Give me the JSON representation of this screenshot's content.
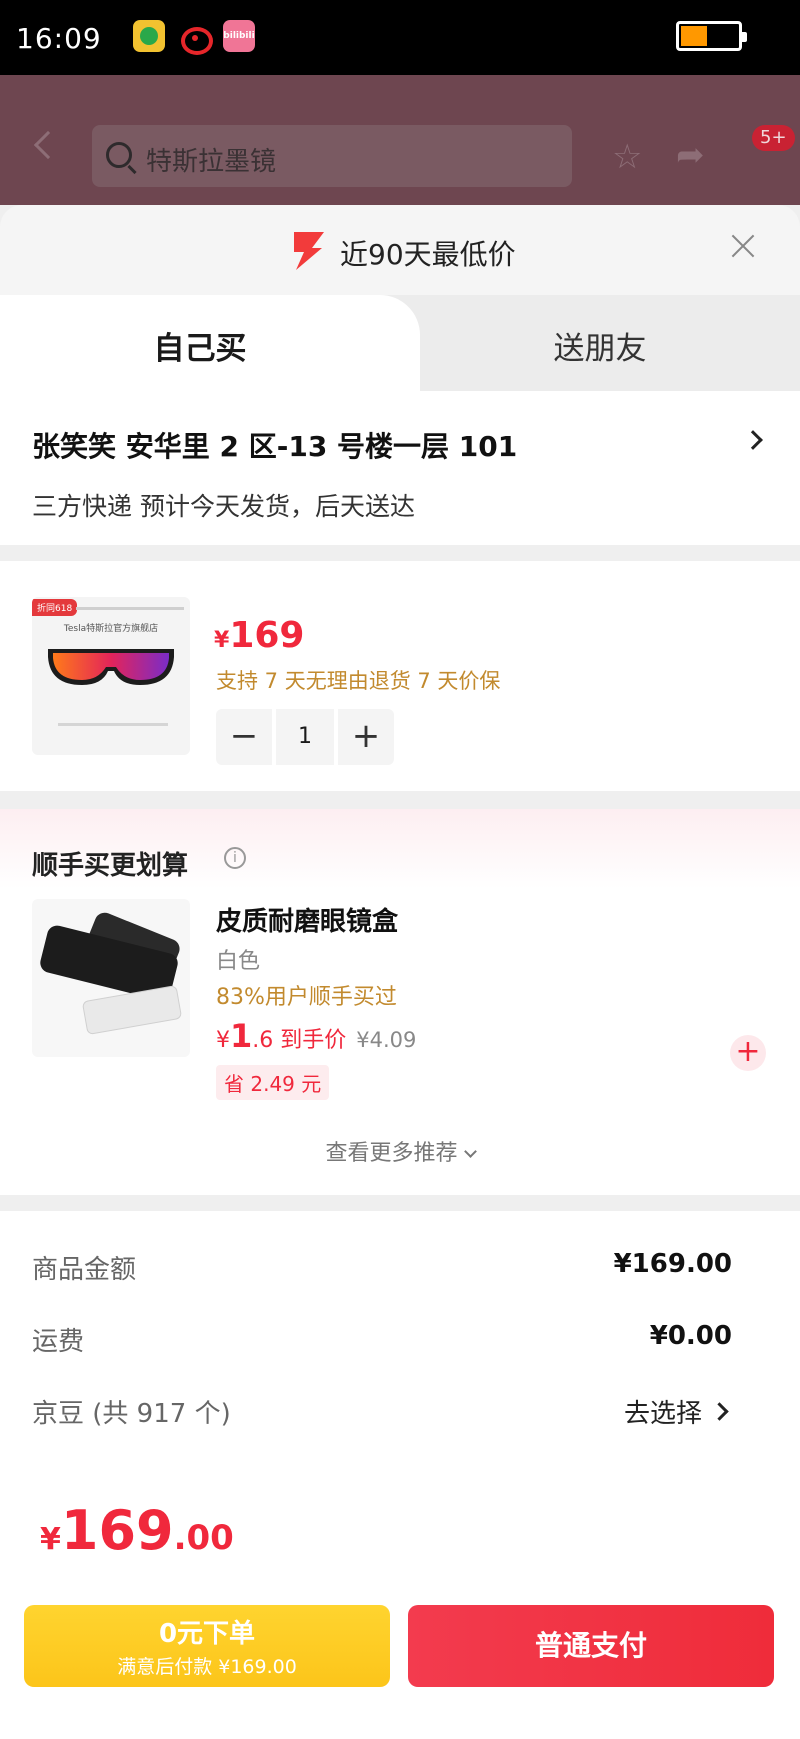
{
  "status_bar": {
    "time": "16:09",
    "app_badge": "bilibili"
  },
  "background_page": {
    "search_text": "特斯拉墨镜",
    "message_badge": "5+"
  },
  "sheet": {
    "header_title": "近90天最低价",
    "tabs": [
      {
        "label": "自己买"
      },
      {
        "label": "送朋友"
      }
    ],
    "address": {
      "line": "张笑笑  安华里 2 区-13 号楼一层 101",
      "shipping": "三方快递  预计今天发货，后天送达"
    },
    "product": {
      "tag": "折同618",
      "thumb_caption": "Tesla特斯拉官方旗舰店",
      "price_symbol": "¥",
      "price": "169",
      "policy": "支持 7 天无理由退货   7 天价保",
      "quantity": "1",
      "minus_label": "−",
      "plus_label": "+"
    },
    "addon": {
      "section_title": "顺手买更划算",
      "info_glyph": "i",
      "item": {
        "name": "皮质耐磨眼镜盒",
        "color": "白色",
        "users": "83%用户顺手买过",
        "price_symbol": "¥",
        "price_int": "1",
        "price_dec": ".6",
        "price_suffix": " 到手价",
        "orig_price": "¥4.09",
        "saving": "省 2.49 元",
        "add_label": "+"
      },
      "more_label": "查看更多推荐"
    },
    "summary": {
      "rows": [
        {
          "label": "商品金额",
          "value": "¥169.00"
        },
        {
          "label": "运费",
          "value": "¥0.00"
        },
        {
          "label": "京豆 (共 917 个)",
          "value": "去选择"
        }
      ]
    },
    "footer": {
      "total_symbol": "¥",
      "total_int": "169",
      "total_dec": ".00",
      "later_title": "0元下单",
      "later_sub": "满意后付款 ¥169.00",
      "pay_label": "普通支付"
    }
  },
  "colors": {
    "accent_red": "#f0283c",
    "gold": "#c28a2e",
    "yellow_button": "#fcc51a"
  }
}
